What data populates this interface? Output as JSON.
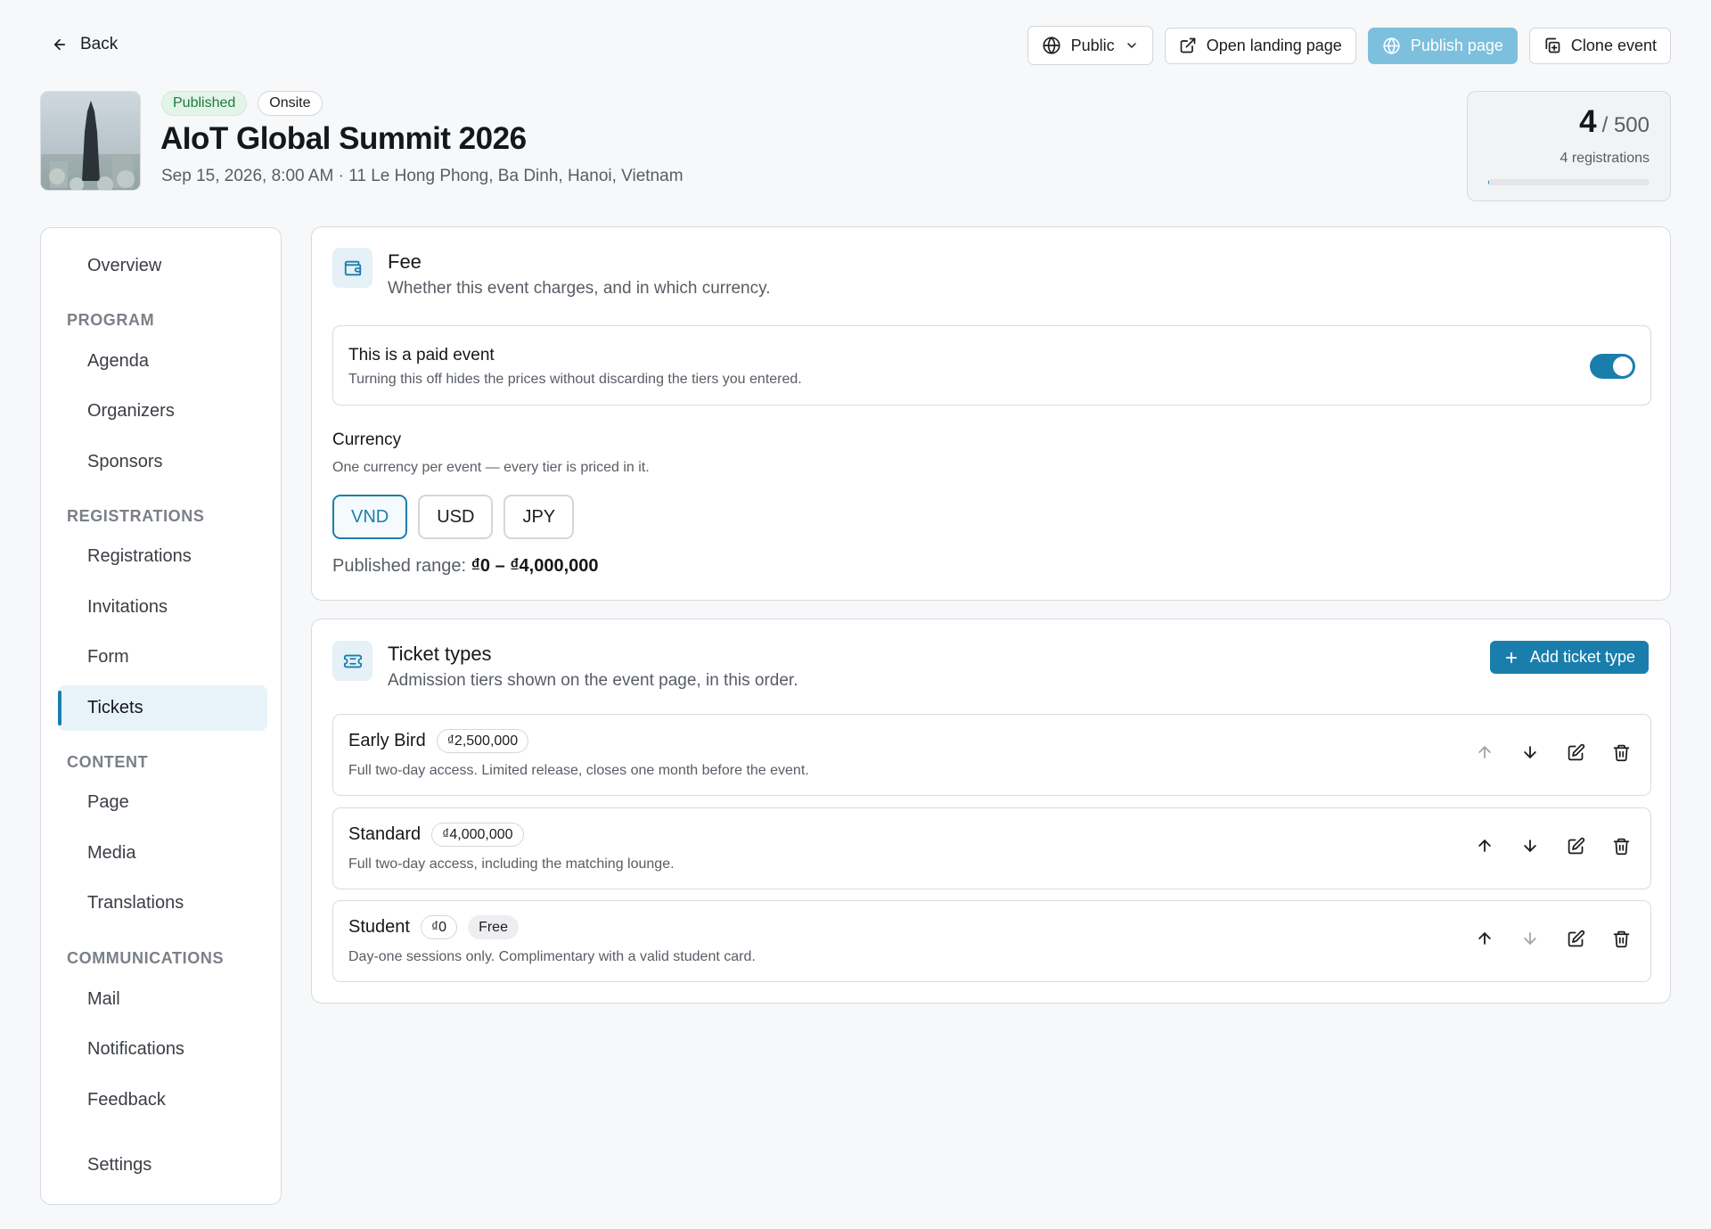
{
  "topbar": {
    "back_label": "Back",
    "visibility_label": "Public",
    "open_landing_label": "Open landing page",
    "publish_label": "Publish page",
    "clone_label": "Clone event"
  },
  "event": {
    "status": "Published",
    "mode": "Onsite",
    "title": "AIoT Global Summit 2026",
    "subtitle": "Sep 15, 2026, 8:00 AM · 11 Le Hong Phong, Ba Dinh, Hanoi, Vietnam"
  },
  "registrations": {
    "count": "4",
    "capacity": "/ 500",
    "label": "4 registrations",
    "fill_fraction": 0.008
  },
  "sidebar": {
    "overview": "Overview",
    "program": {
      "title": "PROGRAM",
      "items": [
        "Agenda",
        "Organizers",
        "Sponsors"
      ]
    },
    "registrations": {
      "title": "REGISTRATIONS",
      "items": [
        "Registrations",
        "Invitations",
        "Form",
        "Tickets"
      ]
    },
    "content": {
      "title": "CONTENT",
      "items": [
        "Page",
        "Media",
        "Translations"
      ]
    },
    "communications": {
      "title": "COMMUNICATIONS",
      "items": [
        "Mail",
        "Notifications",
        "Feedback"
      ]
    },
    "settings": "Settings",
    "active": "Tickets"
  },
  "fee": {
    "title": "Fee",
    "description": "Whether this event charges, and in which currency.",
    "paid_title": "This is a paid event",
    "paid_description": "Turning this off hides the prices without discarding the tiers you entered.",
    "paid_enabled": true,
    "currency_label": "Currency",
    "currency_description": "One currency per event — every tier is priced in it.",
    "currencies": [
      "VND",
      "USD",
      "JPY"
    ],
    "selected_currency": "VND",
    "range_label": "Published range:",
    "range_value": "₫0 – ₫4,000,000"
  },
  "tickets": {
    "title": "Ticket types",
    "description": "Admission tiers shown on the event page, in this order.",
    "add_label": "Add ticket type",
    "items": [
      {
        "name": "Early Bird",
        "price": "₫2,500,000",
        "tag": "",
        "description": "Full two-day access. Limited release, closes one month before the event."
      },
      {
        "name": "Standard",
        "price": "₫4,000,000",
        "tag": "",
        "description": "Full two-day access, including the matching lounge."
      },
      {
        "name": "Student",
        "price": "₫0",
        "tag": "Free",
        "description": "Day-one sessions only. Complimentary with a valid student card."
      }
    ]
  },
  "colors": {
    "accent": "#1a7eac",
    "publish_disabled": "#7cc0dd",
    "published_badge_bg": "#e3f4e8",
    "published_badge_text": "#1f7a3d"
  },
  "icons": {
    "back": "arrow-left-icon",
    "visibility": "globe-icon",
    "open": "external-link-icon",
    "publish": "globe-icon",
    "clone": "copy-icon",
    "fee": "wallet-icon",
    "tickets": "ticket-icon",
    "add": "plus-icon",
    "move_up": "arrow-up-icon",
    "move_down": "arrow-down-icon",
    "edit": "edit-icon",
    "delete": "trash-icon"
  }
}
